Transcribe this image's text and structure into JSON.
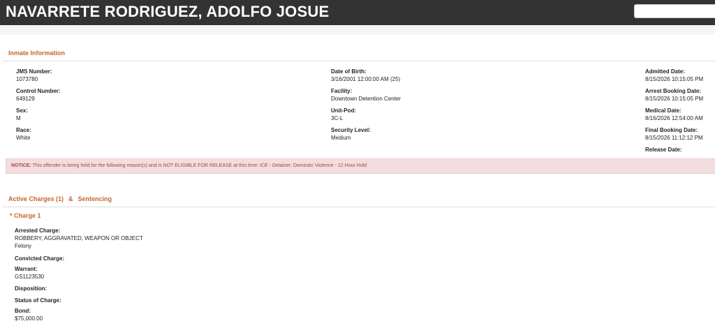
{
  "header": {
    "title": "NAVARRETE RODRIGUEZ, ADOLFO JOSUE",
    "search_value": ""
  },
  "inmate_section": {
    "title": "Inmate Information",
    "col1": [
      {
        "label": "JMS Number:",
        "value": "1073780"
      },
      {
        "label": "Control Number:",
        "value": "649129"
      },
      {
        "label": "Sex:",
        "value": "M"
      },
      {
        "label": "Race:",
        "value": "White"
      }
    ],
    "col2": [
      {
        "label": "Date of Birth:",
        "value": "3/16/2001 12:00:00 AM (25)"
      },
      {
        "label": "Facility:",
        "value": "Downtown Detention Center"
      },
      {
        "label": "Unit-Pod:",
        "value": "3C-L"
      },
      {
        "label": "Security Level:",
        "value": "Medium"
      }
    ],
    "col3": [
      {
        "label": "Admitted Date:",
        "value": "8/15/2026 10:15:05 PM"
      },
      {
        "label": "Arrest Booking Date:",
        "value": "8/15/2026 10:15:05 PM"
      },
      {
        "label": "Medical Date:",
        "value": "8/16/2026 12:54:00 AM"
      },
      {
        "label": "Final Booking Date:",
        "value": "8/15/2026 11:12:12 PM"
      },
      {
        "label": "Release Date:",
        "value": ""
      }
    ]
  },
  "notice": {
    "label": "NOTICE:",
    "text": "This offender is being held for the following reason(s) and is NOT ELIGIBLE FOR RELEASE at this time: ICE - Detainer, Domestic Violence - 12 Hour Hold"
  },
  "charges_section": {
    "title_left": "Active Charges (1)",
    "title_amp": "&",
    "title_right": "Sentencing",
    "charge_title": "* Charge 1",
    "fields": {
      "arrested": {
        "label": "Arrested Charge:",
        "value": "ROBBERY, AGGRAVATED, WEAPON OR OBJECT",
        "value2": "Felony"
      },
      "convicted": {
        "label": "Convicted Charge:",
        "value": ""
      },
      "warrant": {
        "label": "Warrant:",
        "value": "GS1123530"
      },
      "disposition": {
        "label": "Disposition:",
        "value": ""
      },
      "status": {
        "label": "Status of Charge:",
        "value": ""
      },
      "bond": {
        "label": "Bond:",
        "value": "$75,000.00"
      }
    }
  },
  "colors": {
    "header_bg": "#333333",
    "accent": "#c8642a",
    "notice_bg": "#f2dede",
    "notice_text": "#a94442"
  }
}
